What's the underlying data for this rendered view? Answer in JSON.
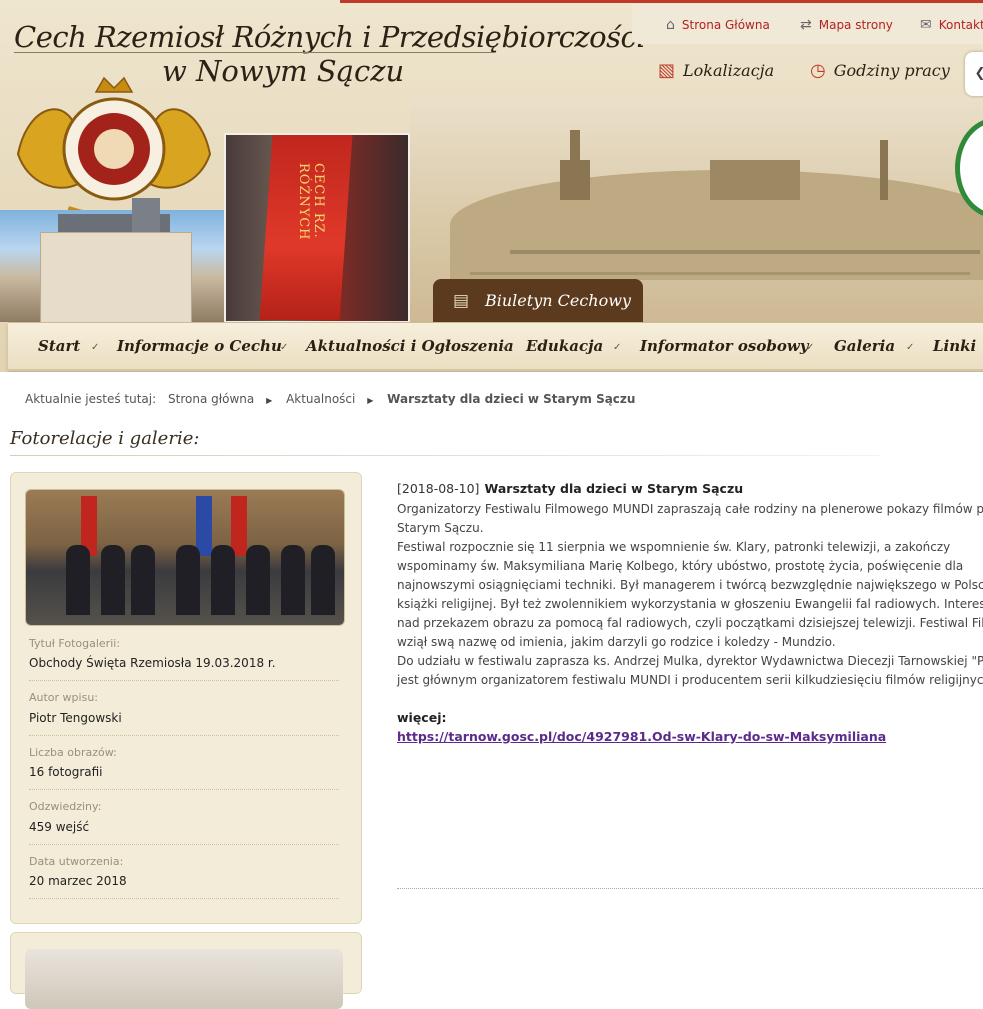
{
  "header": {
    "title_line1": "Cech Rzemiosł Różnych i Przedsiębiorczości",
    "title_line2": "w Nowym Sączu",
    "top_links": [
      {
        "label": "Strona Główna",
        "icon": "home-icon"
      },
      {
        "label": "Mapa strony",
        "icon": "sitemap-icon"
      },
      {
        "label": "Kontakt",
        "icon": "mail-icon"
      }
    ],
    "utility": [
      {
        "label": "Lokalizacja",
        "icon": "map-icon"
      },
      {
        "label": "Godziny pracy",
        "icon": "clock-icon"
      }
    ],
    "banner_flag_text": "CECH RZ. RÓŻNYCH",
    "biuletyn_label": "Biuletyn Cechowy",
    "side_tab_glyph": "❮"
  },
  "nav": {
    "items": [
      "Start",
      "Informacje o Cechu",
      "Aktualności i Ogłoszenia",
      "Edukacja",
      "Informator osobowy",
      "Galeria",
      "Linki"
    ],
    "separator": "✓"
  },
  "breadcrumb": {
    "prefix": "Aktualnie jesteś tutaj:",
    "items": [
      "Strona główna",
      "Aktualności"
    ],
    "current": "Warsztaty dla dzieci w Starym Sączu",
    "separator": "▶"
  },
  "section": {
    "title": "Fotorelacje i galerie:"
  },
  "gallery": {
    "fields": [
      {
        "label": "Tytuł Fotogalerii:",
        "value": "Obchody Święta Rzemiosła 19.03.2018 r."
      },
      {
        "label": "Autor wpisu:",
        "value": "Piotr Tengowski"
      },
      {
        "label": "Liczba obrazów:",
        "value": "16 fotografii"
      },
      {
        "label": "Odzwiedziny:",
        "value": "459 wejść"
      },
      {
        "label": "Data utworzenia:",
        "value": "20 marzec 2018"
      }
    ]
  },
  "article": {
    "date": "[2018-08-10]",
    "title": "Warsztaty dla dzieci w Starym Sączu",
    "lines": [
      "Organizatorzy Festiwalu Filmowego MUNDI zapraszają całe rodziny na plenerowe pokazy filmów przy",
      "Starym Sączu.",
      "Festiwal rozpocznie się 11 sierpnia we wspomnienie św. Klary, patronki telewizji, a zakończy",
      "wspominamy św. Maksymiliana Marię Kolbego, który ubóstwo, prostotę życia, poświęcenie dla",
      "najnowszymi osiągnięciami techniki. Był managerem i twórcą bezwzględnie największego w Polsce",
      "książki religijnej. Był też zwolennikiem wykorzystania w głoszeniu Ewangelii fal radiowych. Interesow",
      "nad przekazem obrazu za pomocą fal radiowych, czyli początkami dzisiejszej telewizji. Festiwal Film",
      "wziął swą nazwę od imienia, jakim darzyli go rodzice i koledzy - Mundzio.",
      "Do udziału w festiwalu zaprasza ks. Andrzej Mulka, dyrektor Wydawnictwa Diecezji Tarnowskiej \"Pro",
      "jest głównym organizatorem festiwalu MUNDI i producentem serii kilkudziesięciu filmów religijnych d"
    ],
    "more_label": "więcej:",
    "more_link": "https://tarnow.gosc.pl/doc/4927981.Od-sw-Klary-do-sw-Maksymiliana"
  },
  "colors": {
    "accent_red": "#b22222",
    "nav_bg": "#ebdfc2",
    "card_bg": "#f3ecd9",
    "link_purple": "#5b2a8c",
    "biuletyn_bg": "#5c3a1e"
  }
}
